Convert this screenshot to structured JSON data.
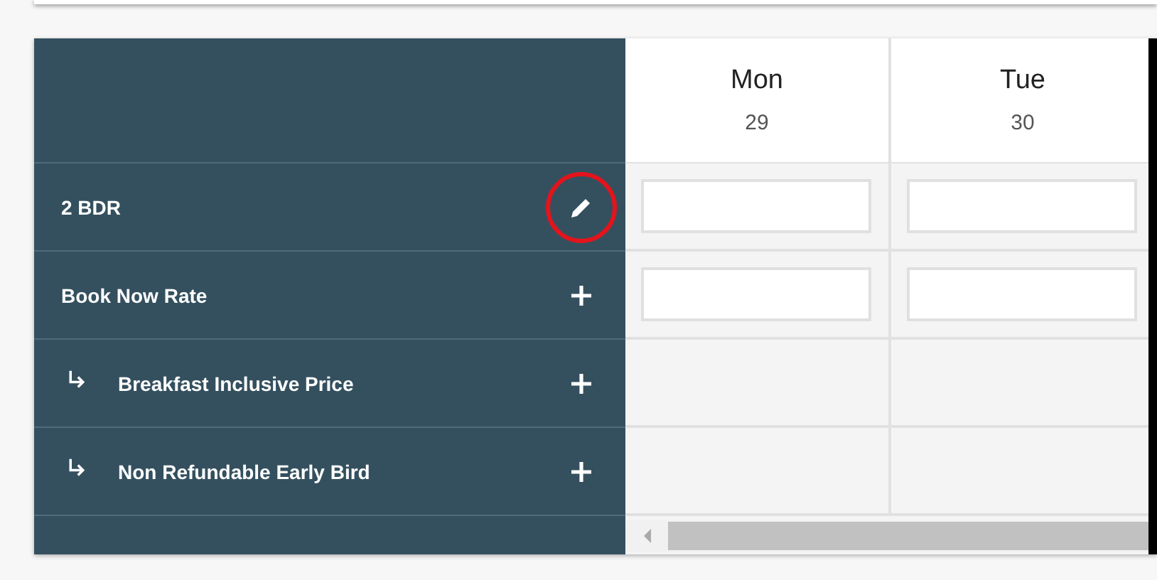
{
  "days": [
    {
      "name": "Mon",
      "date": "29"
    },
    {
      "name": "Tue",
      "date": "30"
    }
  ],
  "rows": [
    {
      "kind": "room",
      "label": "2 BDR",
      "inputs": true,
      "highlighted": true
    },
    {
      "kind": "rate",
      "label": "Book Now Rate",
      "inputs": true,
      "highlighted": false
    },
    {
      "kind": "derived",
      "label": "Breakfast Inclusive Price",
      "inputs": false,
      "highlighted": false
    },
    {
      "kind": "derived",
      "label": "Non Refundable Early Bird",
      "inputs": false,
      "highlighted": false
    }
  ]
}
